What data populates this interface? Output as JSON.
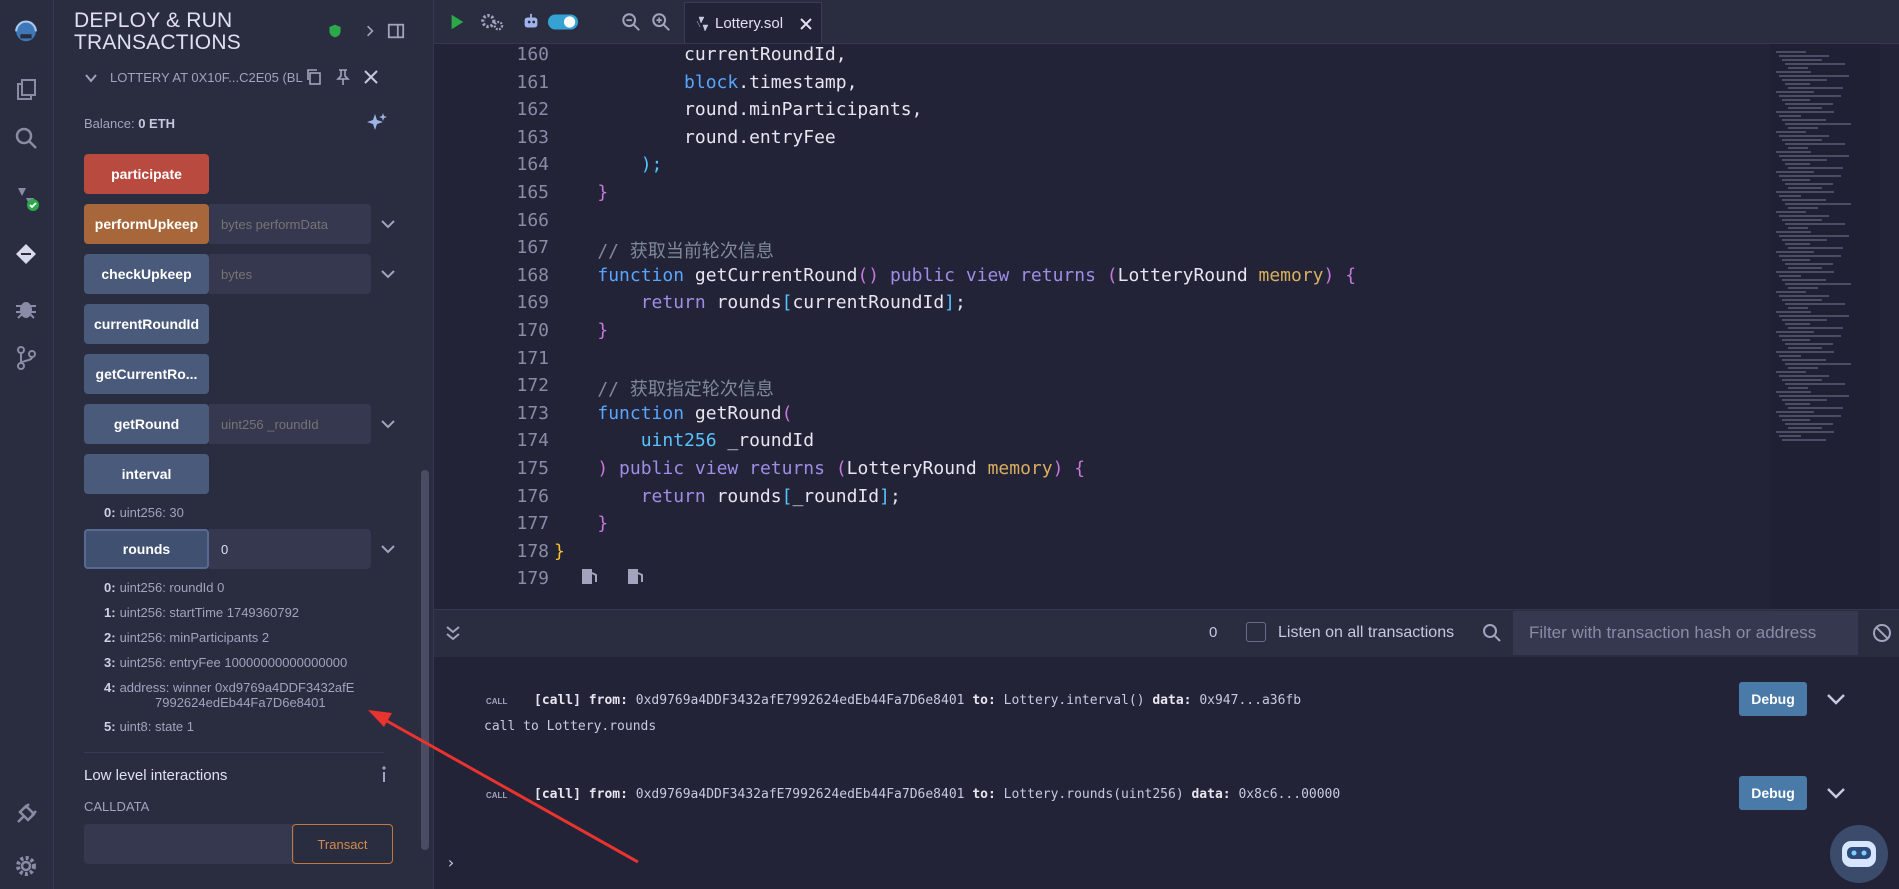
{
  "rail": {
    "icons": [
      "remix-logo-icon",
      "file-explorer-icon",
      "search-icon",
      "solidity-compiler-icon",
      "deploy-run-icon",
      "debugger-icon",
      "git-icon",
      "plugin-manager-icon",
      "settings-icon"
    ]
  },
  "panel": {
    "title": "DEPLOY & RUN TRANSACTIONS",
    "contract_name": "LOTTERY AT 0X10F...C2E05 (BL",
    "balance_label": "Balance:",
    "balance_value": "0 ETH",
    "functions": {
      "participate": {
        "label": "participate",
        "color": "#b84a3f"
      },
      "performUpkeep": {
        "label": "performUpkeep",
        "placeholder": "bytes performData",
        "color": "#a7673a"
      },
      "checkUpkeep": {
        "label": "checkUpkeep",
        "placeholder": "bytes"
      },
      "currentRoundId": {
        "label": "currentRoundId"
      },
      "getCurrentRound": {
        "label": "getCurrentRo..."
      },
      "getRound": {
        "label": "getRound",
        "placeholder": "uint256 _roundId"
      },
      "interval": {
        "label": "interval"
      },
      "rounds": {
        "label": "rounds",
        "value": "0"
      }
    },
    "interval_output": {
      "index": "0:",
      "text": "uint256: 30"
    },
    "rounds_output": [
      {
        "index": "0:",
        "text": "uint256: roundId 0"
      },
      {
        "index": "1:",
        "text": "uint256: startTime 1749360792"
      },
      {
        "index": "2:",
        "text": "uint256: minParticipants 2"
      },
      {
        "index": "3:",
        "text": "uint256: entryFee 10000000000000000"
      },
      {
        "index": "4:",
        "text": "address: winner 0xd9769a4DDF3432afE",
        "text2": "7992624edEb44Fa7D6e8401"
      },
      {
        "index": "5:",
        "text": "uint8: state 1"
      }
    ],
    "low_level_title": "Low level interactions",
    "calldata_label": "CALLDATA",
    "transact_label": "Transact"
  },
  "topbar": {
    "file_tab": "Lottery.sol"
  },
  "code": {
    "lines": [
      {
        "n": "160",
        "parts": [
          [
            "",
            "            currentRoundId,"
          ]
        ]
      },
      {
        "n": "161",
        "parts": [
          [
            "",
            "            "
          ],
          [
            "kw2",
            "block"
          ],
          [
            "",
            ".timestamp,"
          ]
        ]
      },
      {
        "n": "162",
        "parts": [
          [
            "",
            "            round.minParticipants,"
          ]
        ]
      },
      {
        "n": "163",
        "parts": [
          [
            "",
            "            round.entryFee"
          ]
        ]
      },
      {
        "n": "164",
        "parts": [
          [
            "",
            "        "
          ],
          [
            "ty",
            ");"
          ]
        ]
      },
      {
        "n": "165",
        "parts": [
          [
            "",
            "    "
          ],
          [
            "pn",
            "}"
          ]
        ]
      },
      {
        "n": "166",
        "parts": [
          [
            "",
            ""
          ]
        ]
      },
      {
        "n": "167",
        "parts": [
          [
            "cm",
            "    // 获取当前轮次信息"
          ]
        ]
      },
      {
        "n": "168",
        "parts": [
          [
            "",
            "    "
          ],
          [
            "kw2",
            "function"
          ],
          [
            "",
            " getCurrentRound"
          ],
          [
            "pn",
            "()"
          ],
          [
            "",
            " "
          ],
          [
            "kw",
            "public"
          ],
          [
            "",
            " "
          ],
          [
            "kw",
            "view"
          ],
          [
            "",
            " "
          ],
          [
            "kw",
            "returns"
          ],
          [
            "",
            " "
          ],
          [
            "pn",
            "("
          ],
          [
            "",
            "LotteryRound "
          ],
          [
            "st",
            "memory"
          ],
          [
            "pn",
            ")"
          ],
          [
            "",
            " "
          ],
          [
            "pn",
            "{"
          ]
        ]
      },
      {
        "n": "169",
        "parts": [
          [
            "",
            "        "
          ],
          [
            "kw",
            "return"
          ],
          [
            "",
            " rounds"
          ],
          [
            "ty",
            "["
          ],
          [
            "",
            "currentRoundId"
          ],
          [
            "ty",
            "]"
          ],
          [
            "",
            ";"
          ]
        ]
      },
      {
        "n": "170",
        "parts": [
          [
            "",
            "    "
          ],
          [
            "pn",
            "}"
          ]
        ]
      },
      {
        "n": "171",
        "parts": [
          [
            "",
            ""
          ]
        ]
      },
      {
        "n": "172",
        "parts": [
          [
            "cm",
            "    // 获取指定轮次信息"
          ]
        ]
      },
      {
        "n": "173",
        "parts": [
          [
            "",
            "    "
          ],
          [
            "kw2",
            "function"
          ],
          [
            "",
            " getRound"
          ],
          [
            "pn",
            "("
          ]
        ]
      },
      {
        "n": "174",
        "parts": [
          [
            "",
            "        "
          ],
          [
            "ty",
            "uint256"
          ],
          [
            "",
            " _roundId"
          ]
        ]
      },
      {
        "n": "175",
        "parts": [
          [
            "",
            "    "
          ],
          [
            "pn",
            ")"
          ],
          [
            "",
            " "
          ],
          [
            "kw",
            "public"
          ],
          [
            "",
            " "
          ],
          [
            "kw",
            "view"
          ],
          [
            "",
            " "
          ],
          [
            "kw",
            "returns"
          ],
          [
            "",
            " "
          ],
          [
            "pn",
            "("
          ],
          [
            "",
            "LotteryRound "
          ],
          [
            "st",
            "memory"
          ],
          [
            "pn",
            ")"
          ],
          [
            "",
            " "
          ],
          [
            "pn",
            "{"
          ]
        ]
      },
      {
        "n": "176",
        "parts": [
          [
            "",
            "        "
          ],
          [
            "kw",
            "return"
          ],
          [
            "",
            " rounds"
          ],
          [
            "ty",
            "["
          ],
          [
            "",
            "_roundId"
          ],
          [
            "ty",
            "]"
          ],
          [
            "",
            ";"
          ]
        ]
      },
      {
        "n": "177",
        "parts": [
          [
            "",
            "    "
          ],
          [
            "pn",
            "}"
          ]
        ]
      },
      {
        "n": "178",
        "parts": [
          [
            "gold",
            "}"
          ]
        ]
      },
      {
        "n": "179",
        "parts": [
          [
            "",
            ""
          ]
        ]
      }
    ]
  },
  "terminal": {
    "count": "0",
    "listen_label": "Listen on all transactions",
    "filter_placeholder": "Filter with transaction hash or address",
    "call_badge": "CALL",
    "tx1": {
      "kind": "[call]",
      "from_label": "from:",
      "from": "0xd9769a4DDF3432afE7992624edEb44Fa7D6e8401",
      "to_label": "to:",
      "to": "Lottery.interval()",
      "data_label": "data:",
      "data": "0x947...a36fb"
    },
    "note": "call to Lottery.rounds",
    "tx2": {
      "kind": "[call]",
      "from_label": "from:",
      "from": "0xd9769a4DDF3432afE7992624edEb44Fa7D6e8401",
      "to_label": "to:",
      "to": "Lottery.rounds(uint256)",
      "data_label": "data:",
      "data": "0x8c6...00000"
    },
    "debug_label": "Debug",
    "prompt": "›"
  },
  "colors": {
    "accent": "#4a7aa8",
    "arrow": "#e8332f",
    "compile_ok": "#2ba84a"
  }
}
